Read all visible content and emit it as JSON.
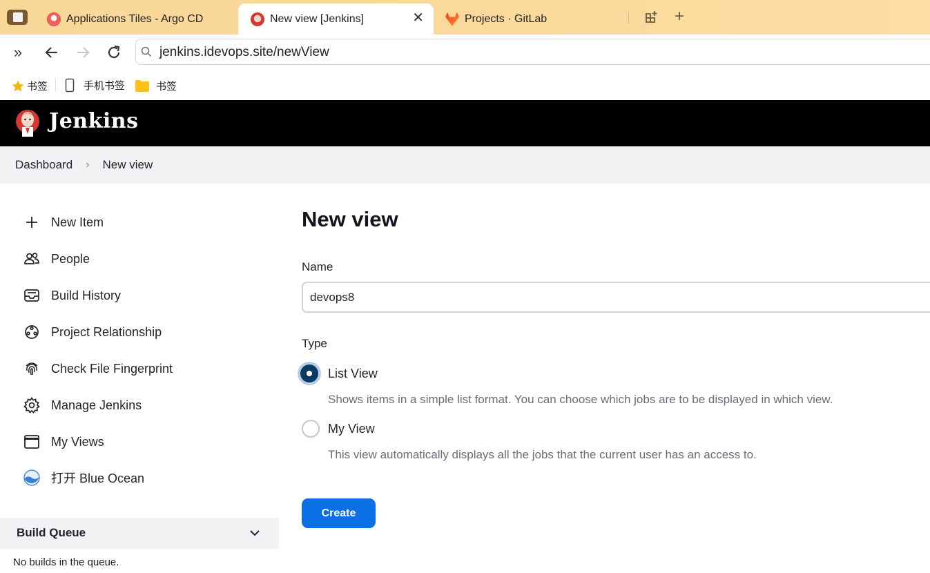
{
  "browser": {
    "tabs": [
      {
        "title": "Applications Tiles - Argo CD",
        "favicon": "argo-icon",
        "active": false
      },
      {
        "title": "New view [Jenkins]",
        "favicon": "jenkins-icon",
        "active": true
      },
      {
        "title": "Projects · GitLab",
        "favicon": "gitlab-icon",
        "active": false
      }
    ],
    "url": "jenkins.idevops.site/newView",
    "bookmarks": [
      {
        "label": "书签",
        "icon": "star-icon"
      },
      {
        "label": "手机书签",
        "icon": "phone-icon"
      },
      {
        "label": "书签",
        "icon": "folder-icon"
      }
    ]
  },
  "header": {
    "title": "Jenkins"
  },
  "breadcrumb": {
    "items": [
      "Dashboard",
      "New view"
    ]
  },
  "sidebar": {
    "items": [
      {
        "label": "New Item",
        "icon": "plus-icon"
      },
      {
        "label": "People",
        "icon": "people-icon"
      },
      {
        "label": "Build History",
        "icon": "inbox-icon"
      },
      {
        "label": "Project Relationship",
        "icon": "relationship-icon"
      },
      {
        "label": "Check File Fingerprint",
        "icon": "fingerprint-icon"
      },
      {
        "label": "Manage Jenkins",
        "icon": "gear-icon"
      },
      {
        "label": "My Views",
        "icon": "window-icon"
      },
      {
        "label": "打开 Blue Ocean",
        "icon": "blue-ocean-icon"
      }
    ],
    "build_queue": {
      "title": "Build Queue",
      "empty_text": "No builds in the queue."
    }
  },
  "main": {
    "title": "New view",
    "name_label": "Name",
    "name_value": "devops8",
    "type_label": "Type",
    "types": [
      {
        "label": "List View",
        "description": "Shows items in a simple list format. You can choose which jobs are to be displayed in which view.",
        "selected": true
      },
      {
        "label": "My View",
        "description": "This view automatically displays all the jobs that the current user has an access to.",
        "selected": false
      }
    ],
    "create_label": "Create"
  },
  "colors": {
    "accent": "#0b6fe6",
    "header_bg": "#000000",
    "radio_selected": "#0b3a63"
  }
}
